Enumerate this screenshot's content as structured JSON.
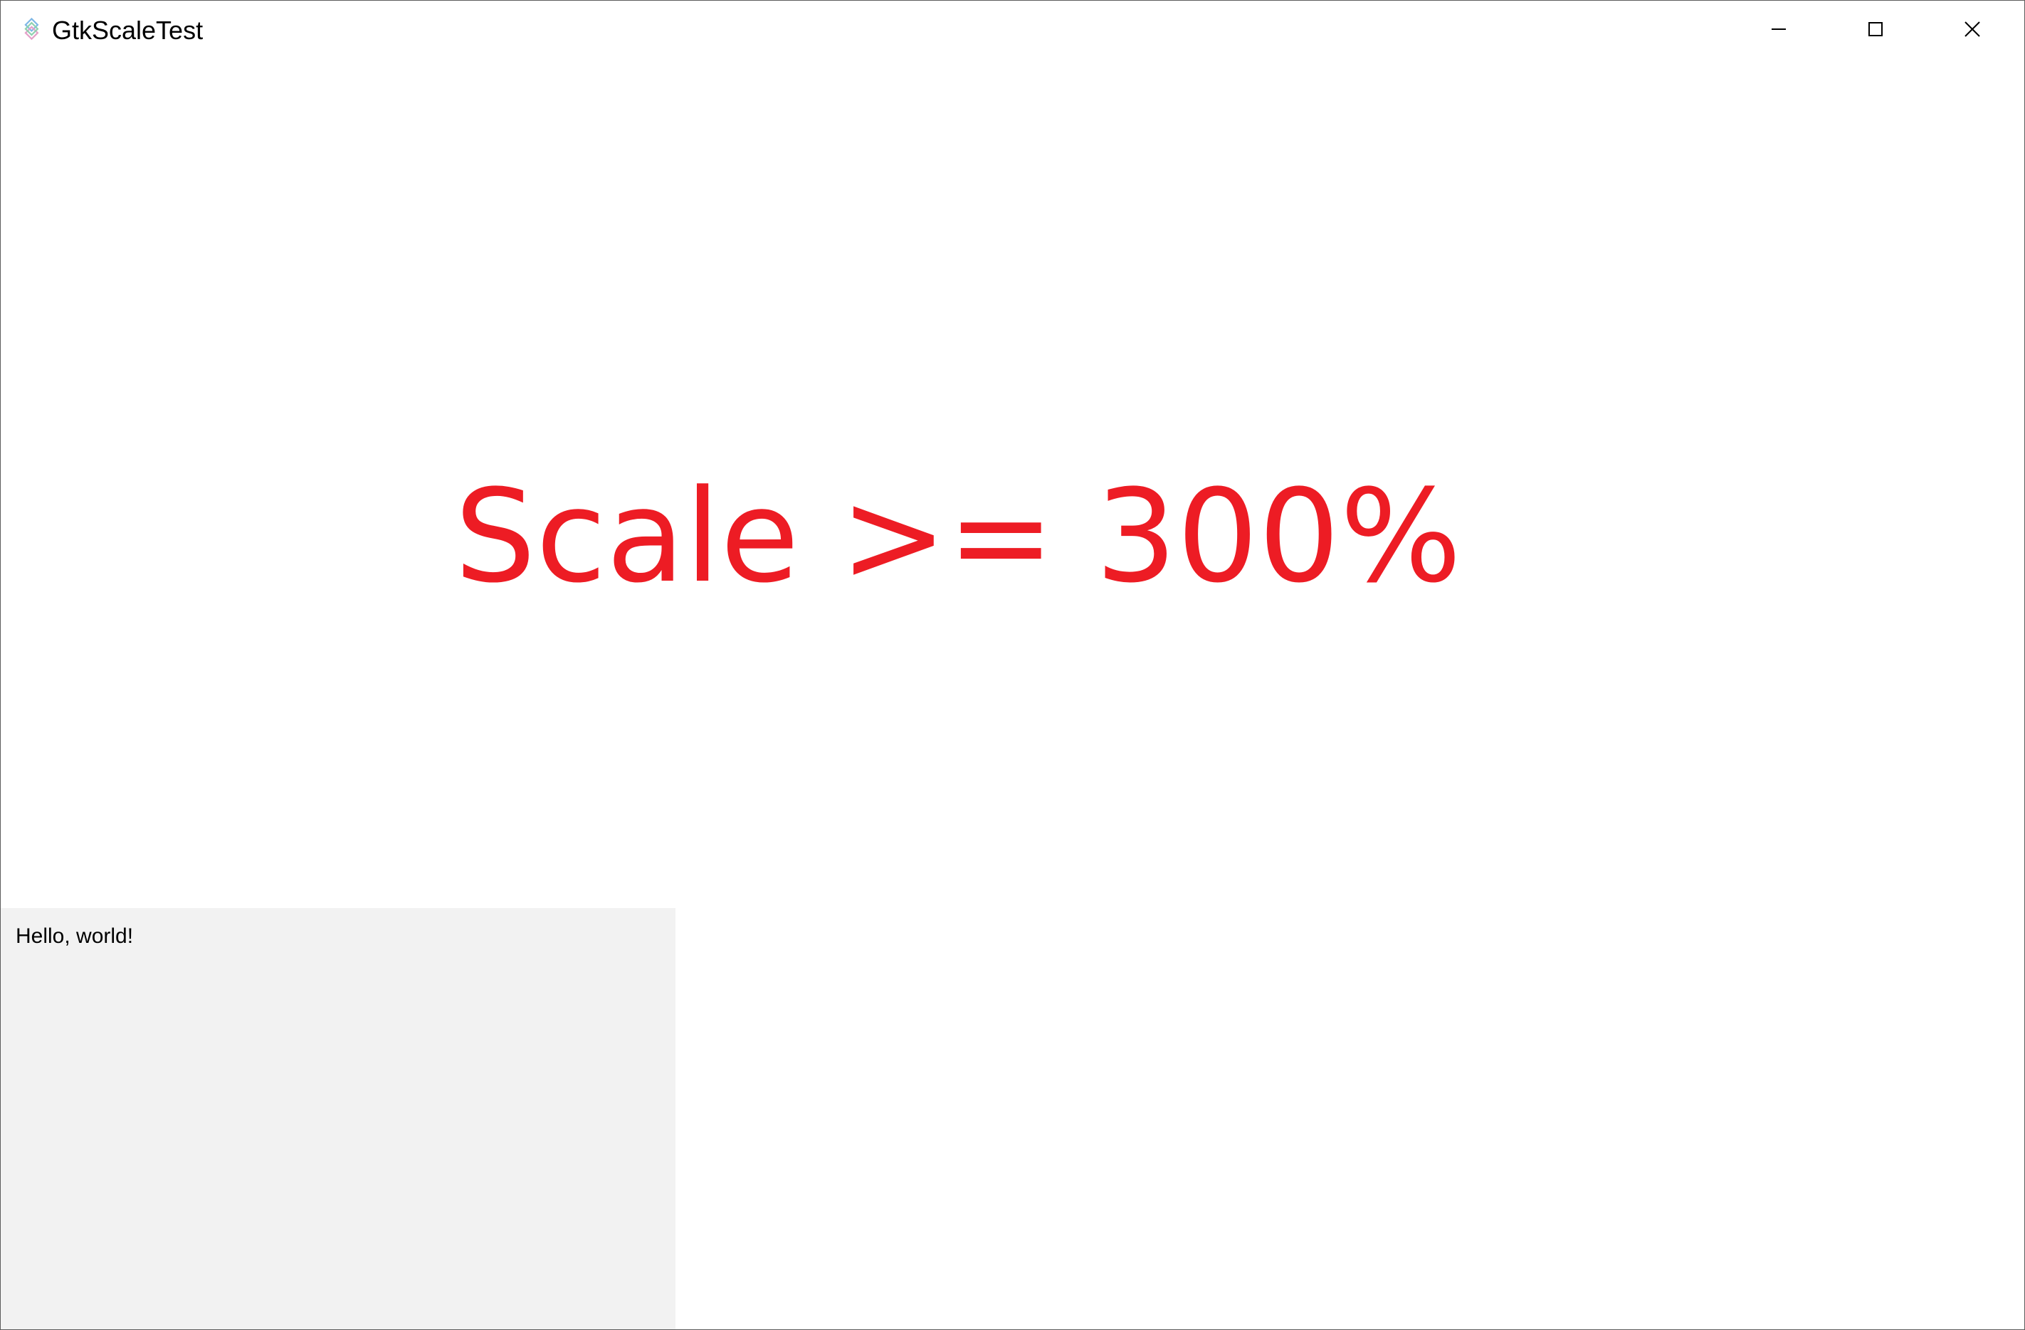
{
  "window": {
    "title": "GtkScaleTest",
    "app_icon": "gtk-logo-icon",
    "controls": {
      "minimize_icon": "minimize-icon",
      "maximize_icon": "maximize-icon",
      "close_icon": "close-icon"
    }
  },
  "main": {
    "scale_text": "Scale >= 300%",
    "scale_text_color": "#ed1c24"
  },
  "panel": {
    "text": "Hello, world!",
    "background": "#f2f2f2"
  }
}
